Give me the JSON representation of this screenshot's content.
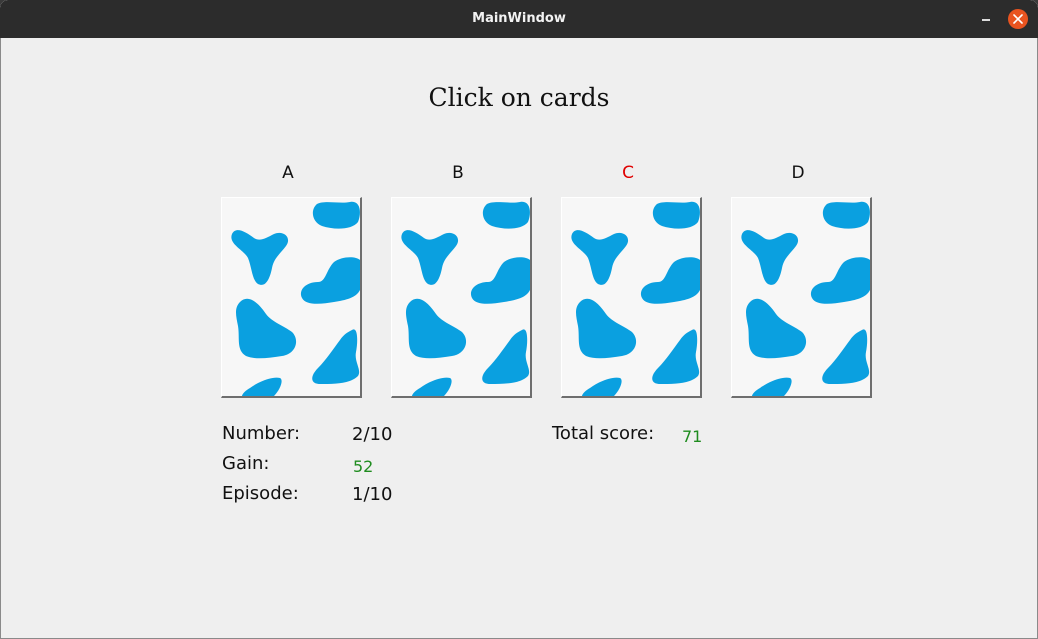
{
  "window": {
    "title": "MainWindow"
  },
  "main": {
    "heading": "Click on cards",
    "decks": [
      {
        "label": "A",
        "selected": false
      },
      {
        "label": "B",
        "selected": false
      },
      {
        "label": "C",
        "selected": true
      },
      {
        "label": "D",
        "selected": false
      }
    ],
    "card_pattern": {
      "blob_color": "#0aa0e0",
      "background": "#f7f7f7"
    }
  },
  "stats": {
    "number_label": "Number:",
    "number_value": "2/10",
    "gain_label": "Gain:",
    "gain_value": "52",
    "episode_label": "Episode:",
    "episode_value": "1/10",
    "total_score_label": "Total score:",
    "total_score_value": "71"
  },
  "colors": {
    "selected_label": "#e00000",
    "value_green": "#1f8c1f",
    "close_button": "#e95420"
  }
}
